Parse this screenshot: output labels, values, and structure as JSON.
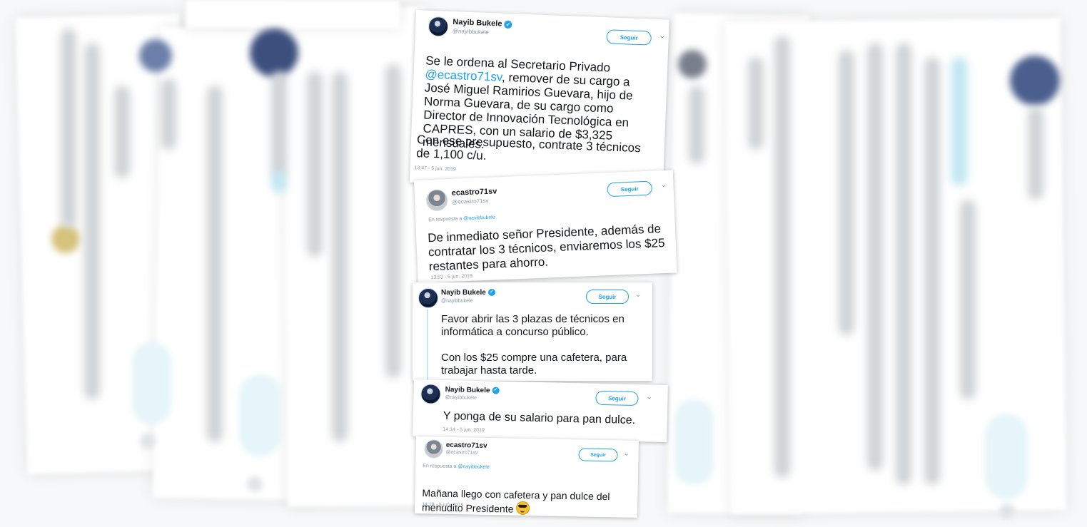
{
  "tweets": [
    {
      "author": "Nayib Bukele",
      "handle": "@nayibbukele",
      "verified": true,
      "follow_label": "Seguir",
      "body_line1_pre": "Se le ordena al Secretario Privado",
      "mention": "@ecastro71sv",
      "body_rest": ", remover de su cargo a José Miguel Ramirios Guevara, hijo de Norma Guevara, de su cargo como Director de Innovación Tecnológica en CAPRES, con un salario de $3,325 mensuales.",
      "body_p2": "Con ese presupuesto, contrate 3 técnicos de 1,100 c/u.",
      "time": "13:47 - 5 jun. 2019"
    },
    {
      "author": "ecastro71sv",
      "handle": "@ecastro71sv",
      "verified": false,
      "follow_label": "Seguir",
      "reply_prefix": "En respuesta a",
      "reply_to": "@nayibbukele",
      "body": "De inmediato señor Presidente, además de contratar los 3 técnicos, enviaremos los $25 restantes para ahorro.",
      "time": "13:53 - 5 jun. 2019"
    },
    {
      "author": "Nayib Bukele",
      "handle": "@nayibbukele",
      "verified": true,
      "follow_label": "Seguir",
      "body_p1": "Favor abrir las 3 plazas de técnicos en informática a concurso público.",
      "body_p2": "Con los $25 compre una cafetera, para trabajar hasta tarde."
    },
    {
      "author": "Nayib Bukele",
      "handle": "@nayibbukele",
      "verified": true,
      "follow_label": "Seguir",
      "body": "Y ponga de su salario para pan dulce.",
      "time": "14:14 - 5 jun. 2019"
    },
    {
      "author": "ecastro71sv",
      "handle": "@ecastro71sv",
      "verified": false,
      "follow_label": "Seguir",
      "reply_prefix": "En respuesta a",
      "reply_to": "@nayibbukele",
      "body": "Mañana llego con cafetera y pan dulce del menudito Presidente",
      "emoji": "sunglasses-emoji",
      "time": "14:18 - 5 jun. 2019"
    }
  ],
  "icons": {
    "verified": "verified-badge-icon",
    "caret": "chevron-down-icon"
  },
  "colors": {
    "twitter_blue": "#1da1f2",
    "text": "#14171a",
    "muted": "#8899a6",
    "background": "#f7f8f9"
  }
}
